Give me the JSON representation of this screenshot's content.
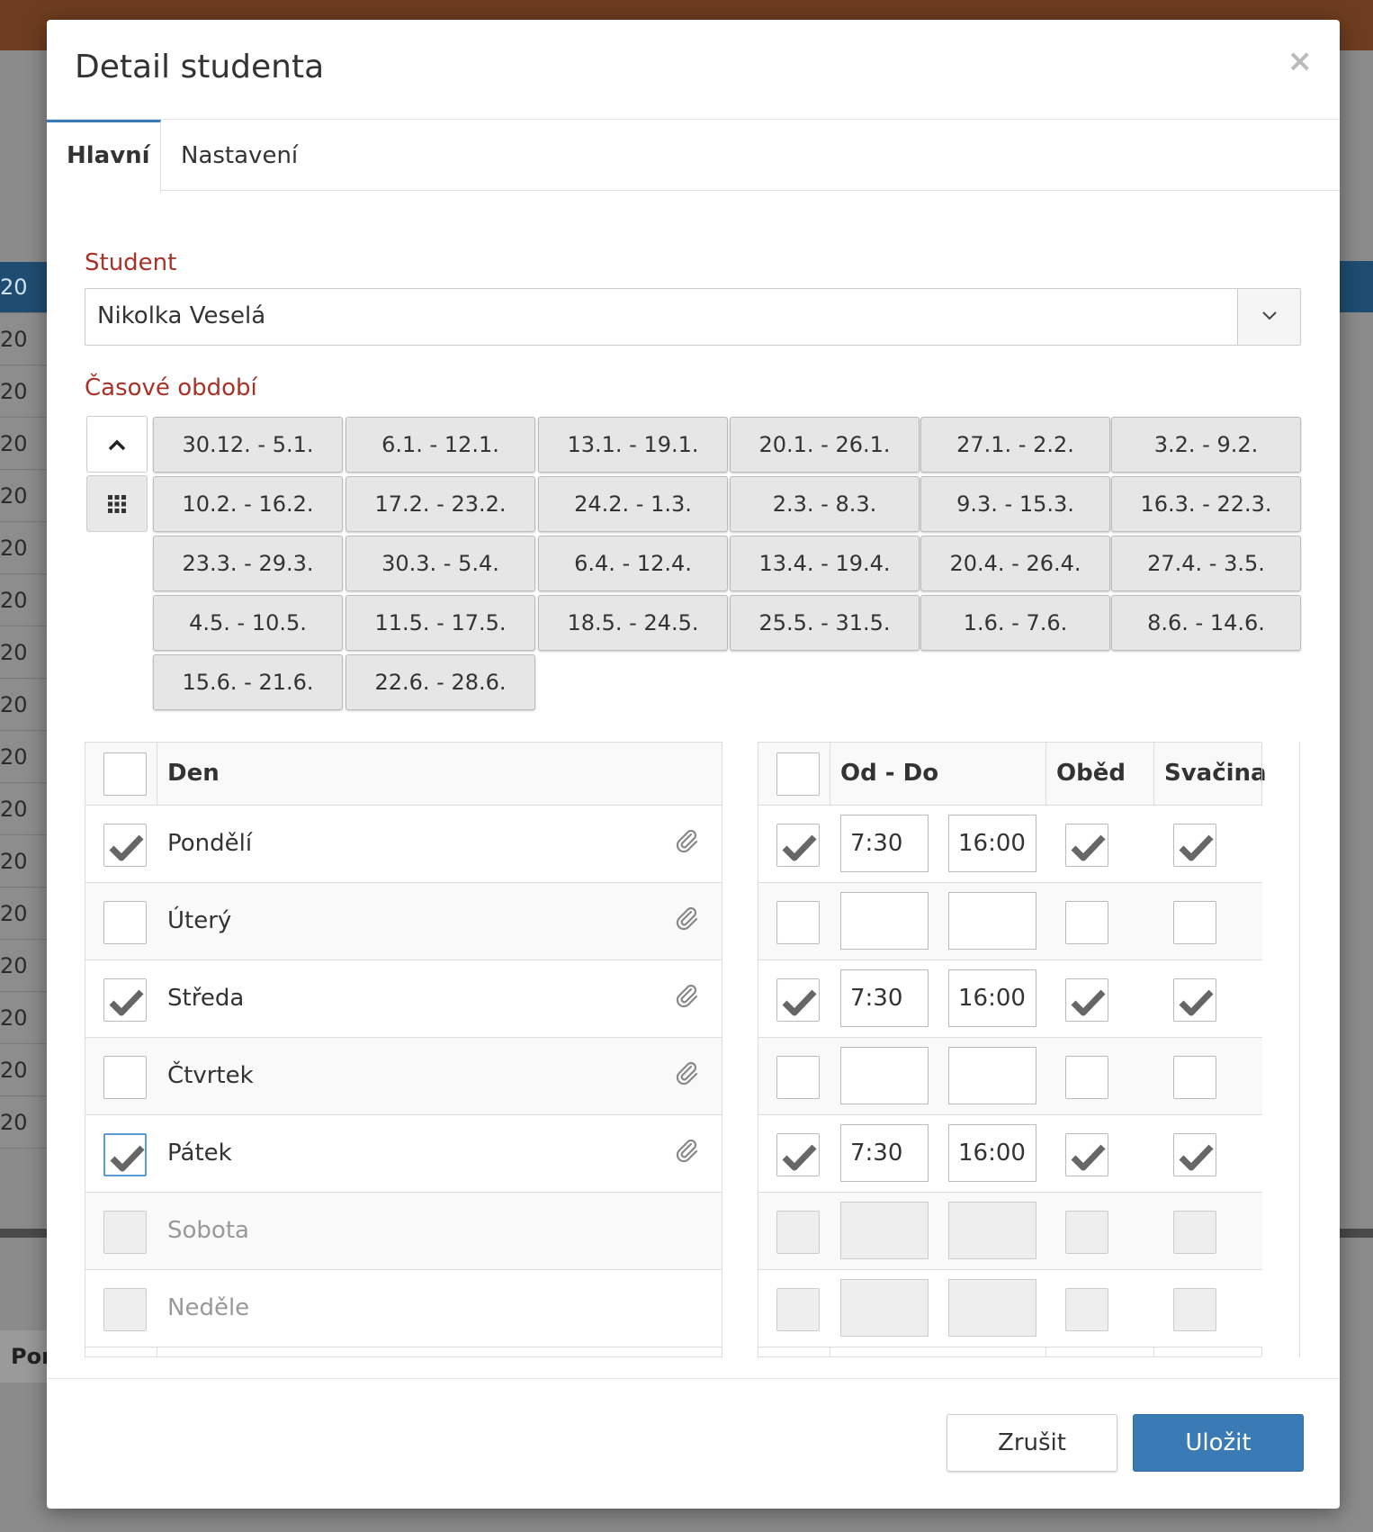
{
  "background": {
    "row_labels": [
      "20",
      "20",
      "20",
      "20",
      "20",
      "20",
      "20",
      "20",
      "20",
      "20",
      "20",
      "20",
      "20",
      "20",
      "20",
      "20",
      "20"
    ],
    "bottom_label": "Por"
  },
  "modal": {
    "title": "Detail studenta",
    "close_symbol": "×"
  },
  "tabs": [
    {
      "label": "Hlavní",
      "active": true
    },
    {
      "label": "Nastavení",
      "active": false
    }
  ],
  "student": {
    "label": "Student",
    "value": "Nikolka Veselá",
    "caret_icon": "chevron-down-icon"
  },
  "period": {
    "label": "Časové období",
    "collapse_icon": "chevron-up-icon",
    "grid_icon": "grid-icon",
    "weeks": [
      "30.12. - 5.1.",
      "6.1. - 12.1.",
      "13.1. - 19.1.",
      "20.1. - 26.1.",
      "27.1. - 2.2.",
      "3.2. - 9.2.",
      "10.2. - 16.2.",
      "17.2. - 23.2.",
      "24.2. - 1.3.",
      "2.3. - 8.3.",
      "9.3. - 15.3.",
      "16.3. - 22.3.",
      "23.3. - 29.3.",
      "30.3. - 5.4.",
      "6.4. - 12.4.",
      "13.4. - 19.4.",
      "20.4. - 26.4.",
      "27.4. - 3.5.",
      "4.5. - 10.5.",
      "11.5. - 17.5.",
      "18.5. - 24.5.",
      "25.5. - 31.5.",
      "1.6. - 7.6.",
      "8.6. - 14.6.",
      "15.6. - 21.6.",
      "22.6. - 28.6."
    ]
  },
  "days_table": {
    "header": "Den",
    "rows": [
      {
        "name": "Pondělí",
        "checked": true,
        "disabled": false
      },
      {
        "name": "Úterý",
        "checked": false,
        "disabled": false
      },
      {
        "name": "Středa",
        "checked": true,
        "disabled": false
      },
      {
        "name": "Čtvrtek",
        "checked": false,
        "disabled": false
      },
      {
        "name": "Pátek",
        "checked": true,
        "disabled": false
      },
      {
        "name": "Sobota",
        "checked": false,
        "disabled": true
      },
      {
        "name": "Neděle",
        "checked": false,
        "disabled": true
      }
    ]
  },
  "times_table": {
    "header_time": "Od - Do",
    "header_lunch": "Oběd",
    "header_snack": "Svačina",
    "rows": [
      {
        "checked": true,
        "from": "7:30",
        "to": "16:00",
        "lunch": true,
        "snack": true,
        "disabled": false
      },
      {
        "checked": false,
        "from": "",
        "to": "",
        "lunch": false,
        "snack": false,
        "disabled": false
      },
      {
        "checked": true,
        "from": "7:30",
        "to": "16:00",
        "lunch": true,
        "snack": true,
        "disabled": false
      },
      {
        "checked": false,
        "from": "",
        "to": "",
        "lunch": false,
        "snack": false,
        "disabled": false
      },
      {
        "checked": true,
        "from": "7:30",
        "to": "16:00",
        "lunch": true,
        "snack": true,
        "disabled": false
      },
      {
        "checked": false,
        "from": "",
        "to": "",
        "lunch": false,
        "snack": false,
        "disabled": true
      },
      {
        "checked": false,
        "from": "",
        "to": "",
        "lunch": false,
        "snack": false,
        "disabled": true
      }
    ]
  },
  "footer": {
    "cancel_label": "Zrušit",
    "save_label": "Uložit"
  },
  "colors": {
    "accent": "#3a7ab5",
    "label_red": "#a93226"
  }
}
